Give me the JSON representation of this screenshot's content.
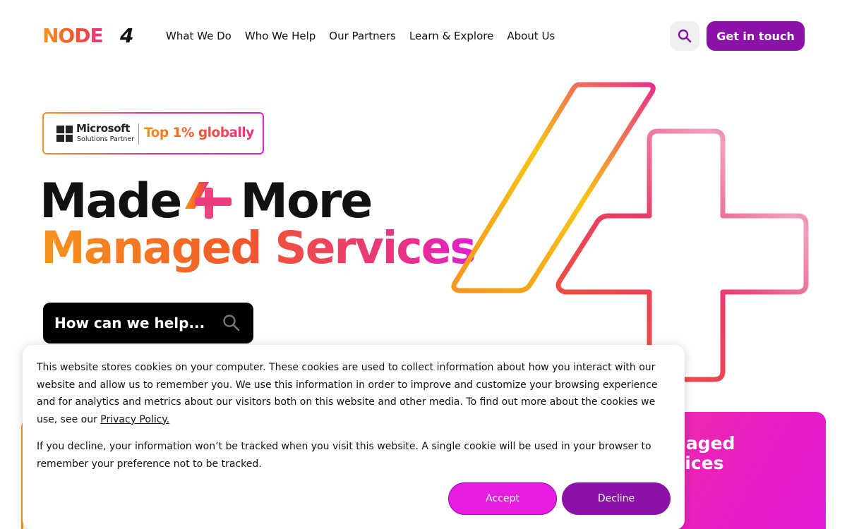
{
  "brand": {
    "logo_text": "NODE",
    "logo_suffix": "4"
  },
  "nav": {
    "items": [
      {
        "label": "What We Do"
      },
      {
        "label": "Who We Help"
      },
      {
        "label": "Our Partners"
      },
      {
        "label": "Learn & Explore"
      },
      {
        "label": "About Us"
      }
    ],
    "search_icon": "search-icon",
    "cta_label": "Get in touch"
  },
  "badge": {
    "company": "Microsoft",
    "subtitle": "Solutions Partner",
    "rank": "Top 1% globally"
  },
  "hero": {
    "line1_a": "Made",
    "line1_b": "More",
    "line2": "Managed Services",
    "search_label": "How can we help..."
  },
  "promo_card": {
    "text_line1": "naged",
    "text_line2": "vices"
  },
  "cookie": {
    "p1_text": "This website stores cookies on your computer. These cookies are used to collect information about how you interact with our website and allow us to remember you. We use this information in order to improve and customize your browsing experience and for analytics and metrics about our visitors both on this website and other media. To find out more about the cookies we use, see our ",
    "privacy_link": "Privacy Policy.",
    "p2_text": "If you decline, your information won’t be tracked when you visit this website. A single cookie will be used in your browser to remember your preference not to be tracked.",
    "accept_label": "Accept",
    "decline_label": "Decline"
  },
  "colors": {
    "brand_orange": "#f7941d",
    "brand_pink": "#e8308a",
    "brand_purple": "#8a12a8",
    "accept_magenta": "#e81de0"
  }
}
